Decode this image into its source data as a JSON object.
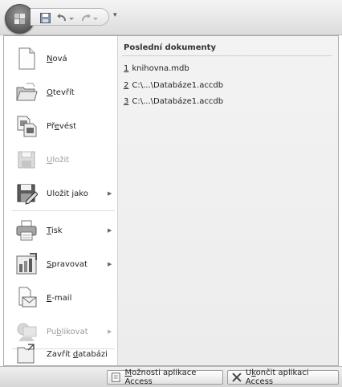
{
  "colors": {
    "toolbar": "#e6e6e6",
    "menu_right_bg": "#f0f0f0",
    "disabled_text": "#9c9c9c"
  },
  "quick_access": {
    "icons": [
      "save-icon",
      "undo-icon",
      "dropdown-icon",
      "redo-icon",
      "dropdown-icon"
    ],
    "more_glyph": "▾"
  },
  "menu": {
    "items": [
      {
        "pre": "",
        "key": "N",
        "post": "ová",
        "icon": "new-document-icon",
        "disabled": false,
        "has_arrow": false
      },
      {
        "pre": "",
        "key": "O",
        "post": "tevřít",
        "icon": "open-folder-icon",
        "disabled": false,
        "has_arrow": false
      },
      {
        "pre": "Př",
        "key": "e",
        "post": "vést",
        "icon": "convert-icon",
        "disabled": false,
        "has_arrow": false
      },
      {
        "pre": "",
        "key": "U",
        "post": "ložit",
        "icon": "save-icon",
        "disabled": true,
        "has_arrow": false
      },
      {
        "pre": "Uložit ",
        "key": "j",
        "post": "ako",
        "icon": "save-as-icon",
        "disabled": false,
        "has_arrow": true
      },
      {
        "pre": "",
        "key": "T",
        "post": "isk",
        "icon": "print-icon",
        "disabled": false,
        "has_arrow": true
      },
      {
        "pre": "",
        "key": "S",
        "post": "pravovat",
        "icon": "manage-icon",
        "disabled": false,
        "has_arrow": true
      },
      {
        "pre": "",
        "key": "E",
        "post": "-mail",
        "icon": "email-icon",
        "disabled": false,
        "has_arrow": false
      },
      {
        "pre": "Pu",
        "key": "b",
        "post": "likovat",
        "icon": "publish-icon",
        "disabled": true,
        "has_arrow": true
      },
      {
        "pre": "Zavřít ",
        "key": "d",
        "post": "atabázi",
        "icon": "close-database-icon",
        "disabled": false,
        "has_arrow": false
      }
    ],
    "arrow_glyph": "▶"
  },
  "recent": {
    "title": "Poslední dokumenty",
    "documents": [
      {
        "num": "1",
        "name": "knihovna.mdb"
      },
      {
        "num": "2",
        "name": "C:\\...\\Databáze1.accdb"
      },
      {
        "num": "3",
        "name": "C:\\...\\Databáze1.accdb"
      }
    ]
  },
  "footer": {
    "options": {
      "pre": "",
      "key": "M",
      "post": "ožnosti aplikace Access"
    },
    "exit": {
      "pre": "U",
      "key": "k",
      "post": "ončit aplikaci Access"
    }
  }
}
